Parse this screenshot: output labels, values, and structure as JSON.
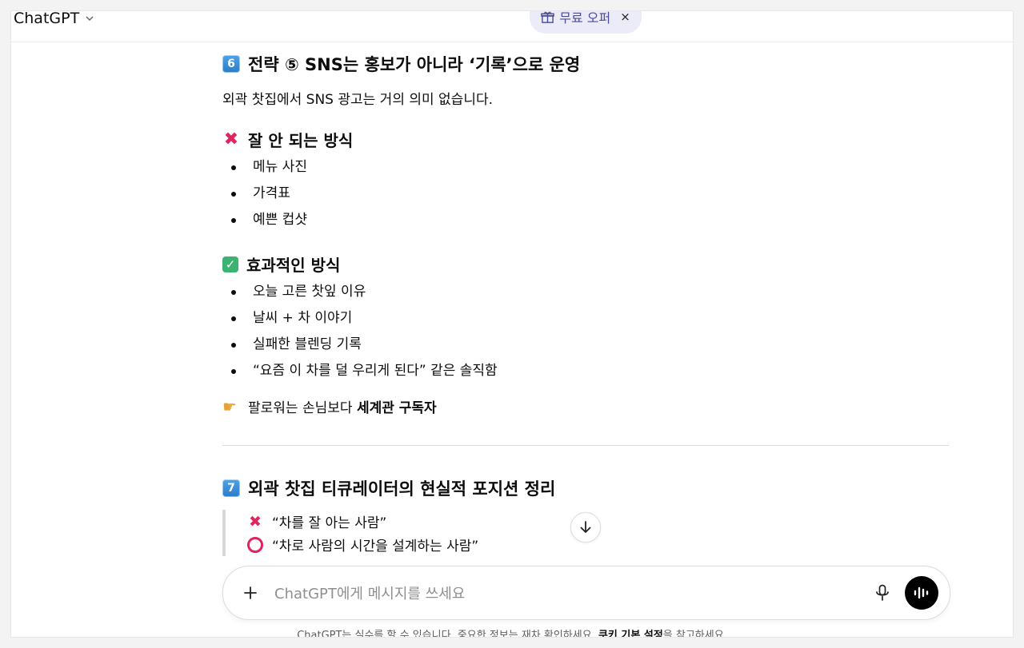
{
  "header": {
    "model_name": "ChatGPT",
    "offer_label": "무료 오퍼",
    "offer_close": "×"
  },
  "section6": {
    "number": "6",
    "title": "전략 ⑤ SNS는 홍보가 아니라 ‘기록’으로 운영",
    "intro": "외곽 찻집에서 SNS 광고는 거의 의미 없습니다.",
    "bad_heading": "잘 안 되는 방식",
    "bad_items": [
      "메뉴 사진",
      "가격표",
      "예쁜 컵샷"
    ],
    "good_heading": "효과적인 방식",
    "good_items": [
      "오늘 고른 찻잎 이유",
      "날씨 + 차 이야기",
      "실패한 블렌딩 기록",
      "“요즘 이 차를 덜 우리게 된다” 같은 솔직함"
    ],
    "point_prefix": "팔로워는 손님보다 ",
    "point_bold": "세계관 구독자"
  },
  "section7": {
    "number": "7",
    "title": "외곽 찻집 티큐레이터의 현실적 포지션 정리",
    "quote_no": "“차를 잘 아는 사람”",
    "quote_yes": "“차로 사람의 시간을 설계하는 사람”"
  },
  "composer": {
    "placeholder": "ChatGPT에게 메시지를 쓰세요"
  },
  "footer": {
    "text_before": "ChatGPT는 실수를 할 수 있습니다. 중요한 정보는 재차 확인하세요. ",
    "link": "쿠키 기본 설정",
    "text_after": "을 참고하세요."
  },
  "colors": {
    "accent_offer": "#ececf9",
    "cross": "#e0245e",
    "check": "#3cb371",
    "number_box": "#2a7cc7"
  },
  "icons": [
    "chevron-down-icon",
    "gift-icon",
    "close-icon",
    "cross-mark-icon",
    "check-box-icon",
    "pointing-hand-icon",
    "circle-icon",
    "arrow-down-icon",
    "plus-icon",
    "microphone-icon",
    "voice-wave-icon"
  ]
}
